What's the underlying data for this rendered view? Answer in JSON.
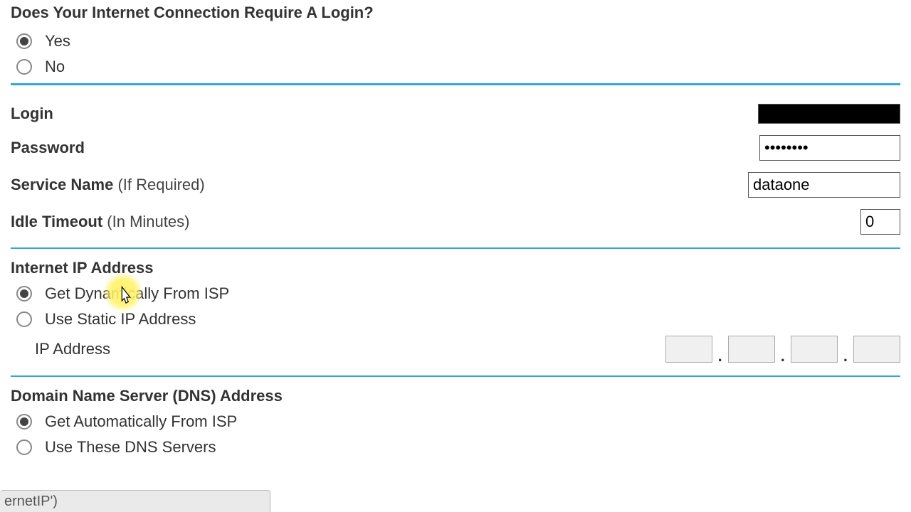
{
  "section1": {
    "title": "Does Your Internet Connection Require A Login?",
    "yes": "Yes",
    "no": "No"
  },
  "login": {
    "label": "Login",
    "value": ""
  },
  "password": {
    "label": "Password",
    "value": "••••••••"
  },
  "service": {
    "label": "Service Name",
    "hint": "(If Required)",
    "value": "dataone"
  },
  "timeout": {
    "label": "Idle Timeout",
    "hint": "(In Minutes)",
    "value": "0"
  },
  "ip": {
    "title": "Internet IP Address",
    "dynamic": "Get Dynamically From ISP",
    "static": "Use Static IP Address",
    "addr_label": "IP Address"
  },
  "dns": {
    "title": "Domain Name Server (DNS) Address",
    "auto": "Get Automatically From ISP",
    "manual": "Use These DNS Servers"
  },
  "tooltip": "ernetIP')"
}
